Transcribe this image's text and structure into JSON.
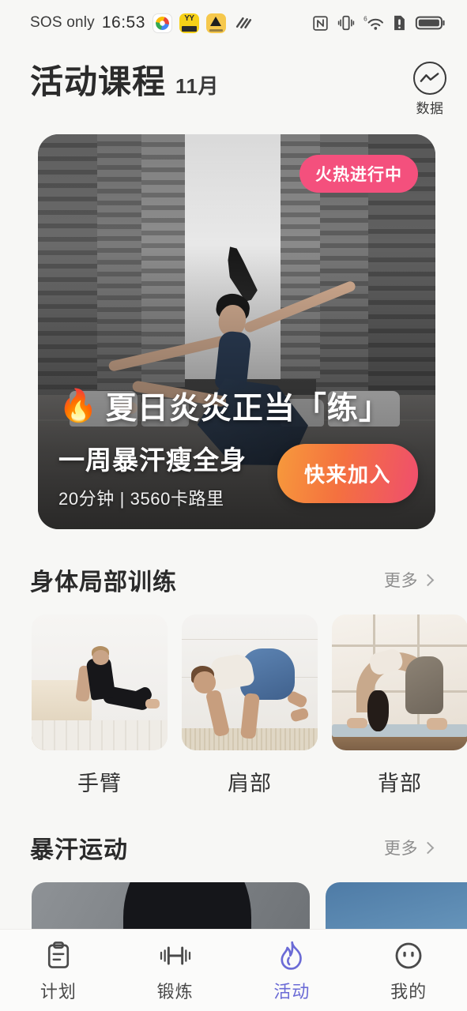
{
  "statusbar": {
    "carrier": "SOS only",
    "time": "16:53",
    "app_icons": [
      "lens-app-icon",
      "yy-app-icon",
      "triangle-app-icon",
      "wave-app-icon"
    ],
    "right_icons": [
      "nfc-icon",
      "vibrate-icon",
      "wifi-6-icon",
      "sim-alert-icon",
      "battery-icon"
    ]
  },
  "header": {
    "title": "活动课程",
    "month": "11月",
    "data_button_label": "数据",
    "data_button_icon": "trend-chart-circle-icon"
  },
  "hero": {
    "badge": "火热进行中",
    "flame_icon": "🔥",
    "title": "夏日炎炎正当「练」",
    "subtitle": "一周暴汗瘦全身",
    "meta": "20分钟 | 3560卡路里",
    "cta_label": "快来加入",
    "badge_color": "#f4507d",
    "cta_gradient_from": "#f79a3c",
    "cta_gradient_to": "#ef4e6e"
  },
  "sections": [
    {
      "title": "身体局部训练",
      "more_label": "更多",
      "cards": [
        {
          "label": "手臂",
          "thumb": "arm-workout-thumb"
        },
        {
          "label": "肩部",
          "thumb": "shoulder-workout-thumb"
        },
        {
          "label": "背部",
          "thumb": "back-workout-thumb"
        }
      ]
    },
    {
      "title": "暴汗运动",
      "more_label": "更多",
      "cards": [
        {
          "label": "",
          "thumb": "sweat-workout-thumb-1"
        },
        {
          "label": "",
          "thumb": "sweat-workout-thumb-2"
        }
      ]
    }
  ],
  "bottom_nav": {
    "active_color": "#6b6bd6",
    "items": [
      {
        "label": "计划",
        "icon": "clipboard-icon",
        "active": false
      },
      {
        "label": "锻炼",
        "icon": "dumbbell-icon",
        "active": false
      },
      {
        "label": "活动",
        "icon": "flame-icon",
        "active": true
      },
      {
        "label": "我的",
        "icon": "face-icon",
        "active": false
      }
    ]
  }
}
